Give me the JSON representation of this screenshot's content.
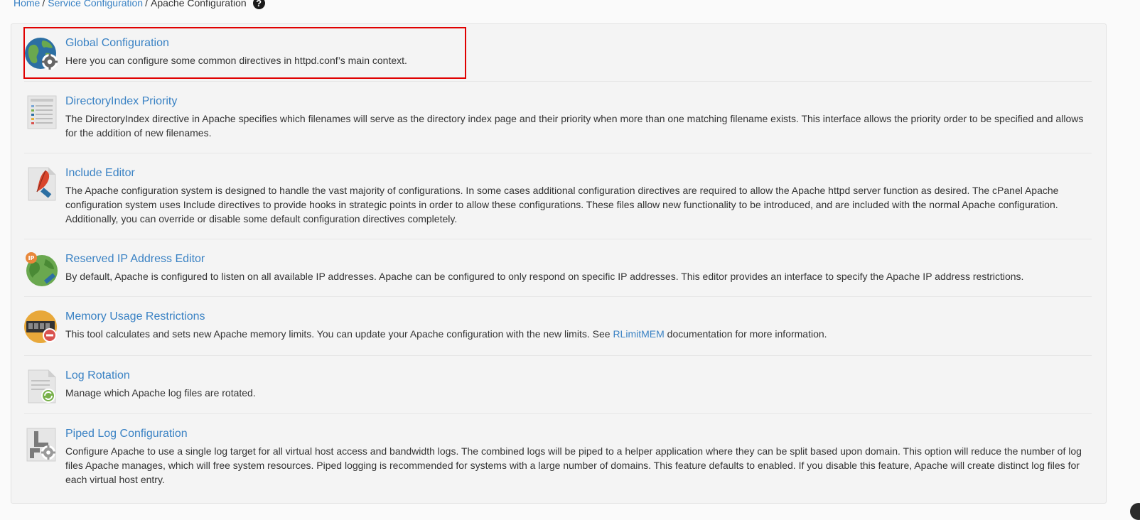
{
  "breadcrumb": {
    "home": "Home",
    "service_configuration": "Service Configuration",
    "current": "Apache Configuration",
    "separator": "/",
    "help_icon": "question-circle-icon"
  },
  "items": [
    {
      "title": "Global Configuration",
      "description": "Here you can configure some common directives in httpd.conf’s main context.",
      "icon": "globe-gear-icon"
    },
    {
      "title": "DirectoryIndex Priority",
      "description": "The DirectoryIndex directive in Apache specifies which filenames will serve as the directory index page and their priority when more than one matching filename exists. This interface allows the priority order to be specified and allows for the addition of new filenames.",
      "icon": "list-document-icon"
    },
    {
      "title": "Include Editor",
      "description": "The Apache configuration system is designed to handle the vast majority of configurations. In some cases additional configuration directives are required to allow the Apache httpd server function as desired. The cPanel Apache configuration system uses Include directives to provide hooks in strategic points in order to allow these configurations. These files allow new functionality to be introduced, and are included with the normal Apache configuration. Additionally, you can override or disable some default configuration directives completely.",
      "icon": "feather-document-icon"
    },
    {
      "title": "Reserved IP Address Editor",
      "description": "By default, Apache is configured to listen on all available IP addresses. Apache can be configured to only respond on specific IP addresses. This editor provides an interface to specify the Apache IP address restrictions.",
      "icon": "ip-globe-icon"
    },
    {
      "title": "Memory Usage Restrictions",
      "description_before": "This tool calculates and sets new Apache memory limits. You can update your Apache configuration with the new limits. See ",
      "description_link": "RLimitMEM",
      "description_after": " documentation for more information.",
      "icon": "memory-restriction-icon"
    },
    {
      "title": "Log Rotation",
      "description": "Manage which Apache log files are rotated.",
      "icon": "log-rotate-icon"
    },
    {
      "title": "Piped Log Configuration",
      "description": "Configure Apache to use a single log target for all virtual host access and bandwidth logs. The combined logs will be piped to a helper application where they can be split based upon domain. This option will reduce the number of log files Apache manages, which will free system resources. Piped logging is recommended for systems with a large number of domains. This feature defaults to enabled. If you disable this feature, Apache will create distinct log files for each virtual host entry.",
      "icon": "pipe-gear-icon"
    }
  ],
  "colors": {
    "link": "#3a82c4",
    "highlight": "#e00000"
  }
}
